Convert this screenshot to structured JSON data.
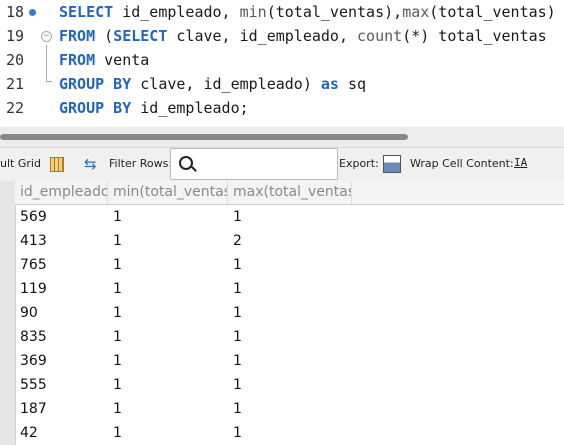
{
  "editor": {
    "lines": [
      {
        "num": "18",
        "parts": [
          {
            "t": "SELECT",
            "k": "kw"
          },
          {
            "t": " id_empleado, ",
            "k": ""
          },
          {
            "t": "min",
            "k": "fn"
          },
          {
            "t": "(total_ventas),",
            "k": ""
          },
          {
            "t": "max",
            "k": "fn"
          },
          {
            "t": "(total_ventas)",
            "k": ""
          }
        ]
      },
      {
        "num": "19",
        "parts": [
          {
            "t": "FROM",
            "k": "kw"
          },
          {
            "t": " (",
            "k": ""
          },
          {
            "t": "SELECT",
            "k": "kw"
          },
          {
            "t": " clave, id_empleado, ",
            "k": ""
          },
          {
            "t": "count",
            "k": "fn"
          },
          {
            "t": "(*) total_ventas",
            "k": ""
          }
        ]
      },
      {
        "num": "20",
        "parts": [
          {
            "t": "FROM",
            "k": "kw"
          },
          {
            "t": " venta",
            "k": ""
          }
        ]
      },
      {
        "num": "21",
        "parts": [
          {
            "t": "GROUP BY",
            "k": "kw"
          },
          {
            "t": " clave, id_empleado) ",
            "k": ""
          },
          {
            "t": "as",
            "k": "kw"
          },
          {
            "t": " sq",
            "k": ""
          }
        ]
      },
      {
        "num": "22",
        "parts": [
          {
            "t": "GROUP BY",
            "k": "kw"
          },
          {
            "t": " id_empleado;",
            "k": ""
          }
        ]
      }
    ],
    "fold_symbol": "−"
  },
  "toolbar": {
    "result_grid_label": "ult Grid",
    "filter_rows_label": "Filter Rows:",
    "filter_value": "",
    "export_label": "Export:",
    "wrap_label": "Wrap Cell Content:",
    "wrap_icon_text": "IA",
    "refresh_icon_glyph": "⇆"
  },
  "grid": {
    "columns": [
      "id_empleado",
      "min(total_ventas)",
      "max(total_ventas)"
    ],
    "rows": [
      [
        "569",
        "1",
        "1"
      ],
      [
        "413",
        "1",
        "2"
      ],
      [
        "765",
        "1",
        "1"
      ],
      [
        "119",
        "1",
        "1"
      ],
      [
        "90",
        "1",
        "1"
      ],
      [
        "835",
        "1",
        "1"
      ],
      [
        "369",
        "1",
        "1"
      ],
      [
        "555",
        "1",
        "1"
      ],
      [
        "187",
        "1",
        "1"
      ],
      [
        "42",
        "1",
        "1"
      ]
    ]
  },
  "colors": {
    "keyword": "#2264c4",
    "marker": "#2f7fd3"
  }
}
